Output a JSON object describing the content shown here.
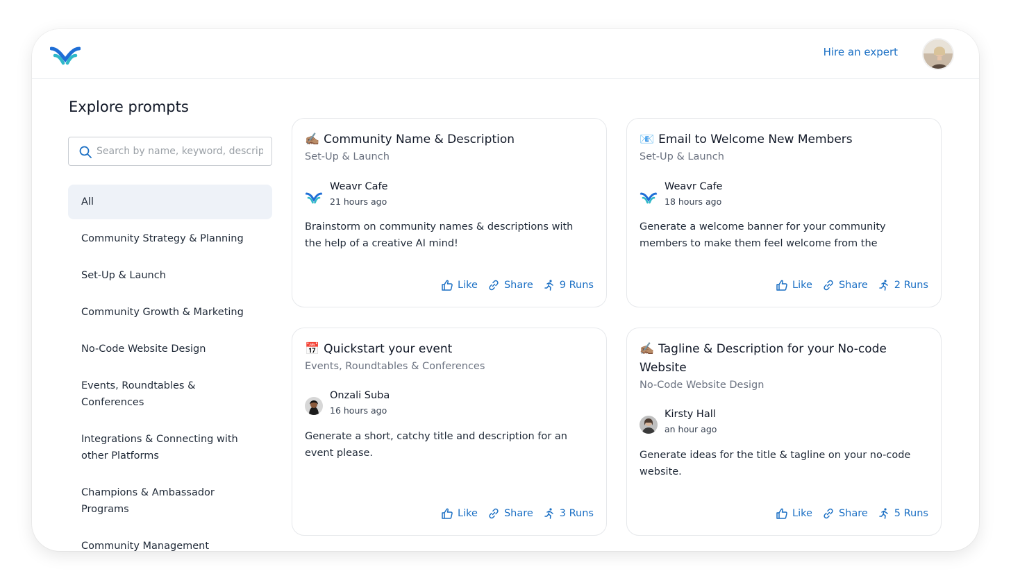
{
  "header": {
    "hire_label": "Hire an expert"
  },
  "page": {
    "title": "Explore prompts"
  },
  "search": {
    "placeholder": "Search by name, keyword, description..."
  },
  "categories": [
    {
      "label": "All",
      "active": true
    },
    {
      "label": "Community Strategy & Planning"
    },
    {
      "label": "Set-Up & Launch"
    },
    {
      "label": "Community Growth & Marketing"
    },
    {
      "label": "No-Code Website Design"
    },
    {
      "label": "Events, Roundtables & Conferences"
    },
    {
      "label": "Integrations & Connecting with other Platforms"
    },
    {
      "label": "Champions & Ambassador Programs"
    },
    {
      "label": "Community Management Packages"
    }
  ],
  "cards": [
    {
      "emoji": "✍🏽",
      "title": "Community Name & Description",
      "category": "Set-Up & Launch",
      "author": "Weavr Cafe",
      "time": "21 hours ago",
      "description": "Brainstorm on community names & descriptions with the help of a creative AI mind!",
      "like": "Like",
      "share": "Share",
      "runs": "9 Runs",
      "avatar_icon": "weavr-logo-icon"
    },
    {
      "emoji": "📧",
      "title": "Email to Welcome New Members",
      "category": "Set-Up & Launch",
      "author": "Weavr Cafe",
      "time": "18 hours ago",
      "description": "Generate a welcome banner for your community members to make them feel welcome from the momen...",
      "like": "Like",
      "share": "Share",
      "runs": "2 Runs",
      "avatar_icon": "weavr-logo-icon"
    },
    {
      "emoji": "📅",
      "title": "Quickstart your event",
      "category": "Events, Roundtables & Conferences",
      "author": "Onzali Suba",
      "time": "16 hours ago",
      "description": "Generate a short, catchy title and description for an event please.",
      "like": "Like",
      "share": "Share",
      "runs": "3 Runs",
      "avatar_icon": "user-avatar-icon"
    },
    {
      "emoji": "✍🏽",
      "title": "Tagline & Description for your No-code Website",
      "category": "No-Code Website Design",
      "author": "Kirsty Hall",
      "time": "an hour ago",
      "description": "Generate ideas for the title & tagline on your no-code website.",
      "like": "Like",
      "share": "Share",
      "runs": "5 Runs",
      "avatar_icon": "user-avatar-icon"
    }
  ],
  "colors": {
    "accent": "#1a6fc4",
    "active_bg": "#eef2f8",
    "logo_blue": "#1e6ed6",
    "logo_teal": "#2fb8c8"
  }
}
